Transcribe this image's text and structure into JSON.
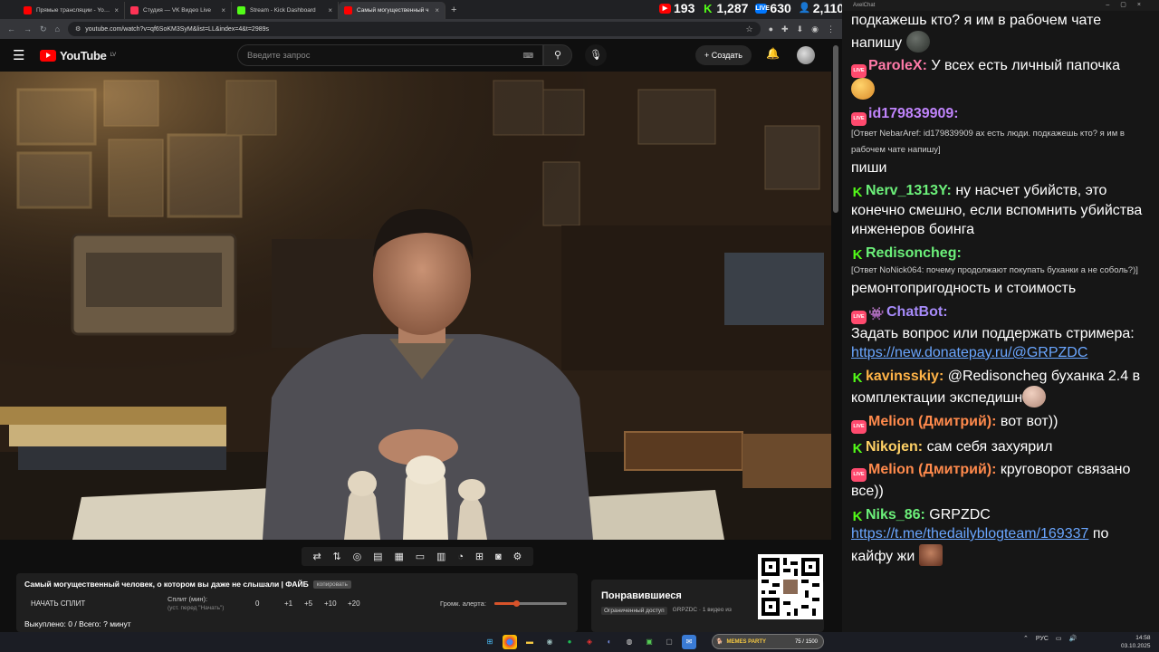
{
  "browser": {
    "tabs": [
      {
        "label": "Прямые трансляции - YouTub",
        "color": "#ff0000",
        "active": false
      },
      {
        "label": "Студия — VK Видео Live",
        "color": "#ff3355",
        "active": false
      },
      {
        "label": "Stream - Kick Dashboard",
        "color": "#53fc18",
        "active": false
      },
      {
        "label": "Самый могущественный ч",
        "color": "#ff0000",
        "active": true
      }
    ],
    "url": "youtube.com/watch?v=qf6SoKM3SyM&list=LL&index=4&t=2989s"
  },
  "stats": [
    {
      "icon": "youtube-icon",
      "value": "193",
      "color": "#ff0000"
    },
    {
      "icon": "kick-icon",
      "value": "1,287",
      "color": "#53fc18"
    },
    {
      "icon": "vk-live-icon",
      "value": "630",
      "color": "#0077ff"
    },
    {
      "icon": "viewers-icon",
      "value": "2,110",
      "color": "#7ab7ff"
    }
  ],
  "youtube": {
    "logo_text": "YouTube",
    "region": "LV",
    "search_placeholder": "Введите запрос",
    "create_label": "Создать"
  },
  "panel": {
    "title": "Самый могущественный человек, о котором вы даже не слышали | ФАЙБ",
    "copy_label": "копировать",
    "split_button": "НАЧАТЬ СПЛИТ",
    "split_label": "Сплит (мин):",
    "split_hint": "(уст. перед \"Начать\")",
    "split_value": "0",
    "step_buttons": [
      "+1",
      "+5",
      "+10",
      "+20"
    ],
    "alert_label": "Громк. алерта:",
    "alert_level": 0.3,
    "paid_line": "Выкуплено: 0 / Всего: ? минут"
  },
  "liked": {
    "title": "Понравившиеся",
    "access": "Ограниченный доступ",
    "channel": "GRPZDC · 1 видео из"
  },
  "chat": {
    "window_title": "AxelChat",
    "messages": [
      {
        "platform": "none",
        "nick": "",
        "nick_color": "#ffffff",
        "reply": "",
        "text": "подкажешь кто? я им в рабочем чате напишу",
        "emote": "#3a3f3a",
        "link": ""
      },
      {
        "platform": "live",
        "nick": "ParoleX:",
        "nick_color": "#ff7aa8",
        "reply": "",
        "text": "У всех есть личный папочка",
        "emote": "#f2b13a",
        "link": ""
      },
      {
        "platform": "live",
        "nick": "id179839909:",
        "nick_color": "#c084fc",
        "reply": "[Ответ NebarAref: id179839909 ах есть люди. подкажешь кто? я им в рабочем чате напишу]",
        "text": "пиши",
        "emote": "",
        "link": ""
      },
      {
        "platform": "kick",
        "nick": "Nerv_1313Y:",
        "nick_color": "#6cf07a",
        "reply": "",
        "text": "ну насчет убийств, это конечно смешно, если вспомнить убийства инженеров боинга",
        "emote": "",
        "link": ""
      },
      {
        "platform": "kick",
        "nick": "Redisoncheg:",
        "nick_color": "#6cf07a",
        "reply": "[Ответ NoNick064: почему продолжают покупать буханки а не соболь?)]",
        "text": "ремонтопригодность и стоимость",
        "emote": "",
        "link": ""
      },
      {
        "platform": "live-bot",
        "nick": "ChatBot:",
        "nick_color": "#a78bfa",
        "reply": "",
        "text": "Задать вопрос или поддержать стримера:",
        "emote": "",
        "link": "https://new.donatepay.ru/@GRPZDC"
      },
      {
        "platform": "kick",
        "nick": "kavinsskiy:",
        "nick_color": "#ffb347",
        "reply": "",
        "text": "@Redisoncheg буханка 2.4 в комплектации экспедишн",
        "emote": "#e8c4b0",
        "link": ""
      },
      {
        "platform": "live",
        "nick": "Melion (Дмитрий):",
        "nick_color": "#ff8a4c",
        "reply": "",
        "text": "вот вот))",
        "emote": "",
        "link": ""
      },
      {
        "platform": "kick",
        "nick": "Nikojen:",
        "nick_color": "#ffd166",
        "reply": "",
        "text": "сам себя захуярил",
        "emote": "",
        "link": ""
      },
      {
        "platform": "live",
        "nick": "Melion (Дмитрий):",
        "nick_color": "#ff8a4c",
        "reply": "",
        "text": "круговорот связано все))",
        "emote": "",
        "link": ""
      },
      {
        "platform": "kick",
        "nick": "Niks_86:",
        "nick_color": "#6cf07a",
        "reply": "",
        "text": "GRPZDC",
        "emote": "#a06040",
        "link": "https://t.me/thedailyblogteam/169337",
        "after_link": "по кайфу жи"
      }
    ]
  },
  "taskbar": {
    "memes_label": "MEMES PARTY",
    "memes_value": "75 / 1500",
    "lang": "РУС",
    "time": "14:58",
    "date": "03.10.2025"
  }
}
